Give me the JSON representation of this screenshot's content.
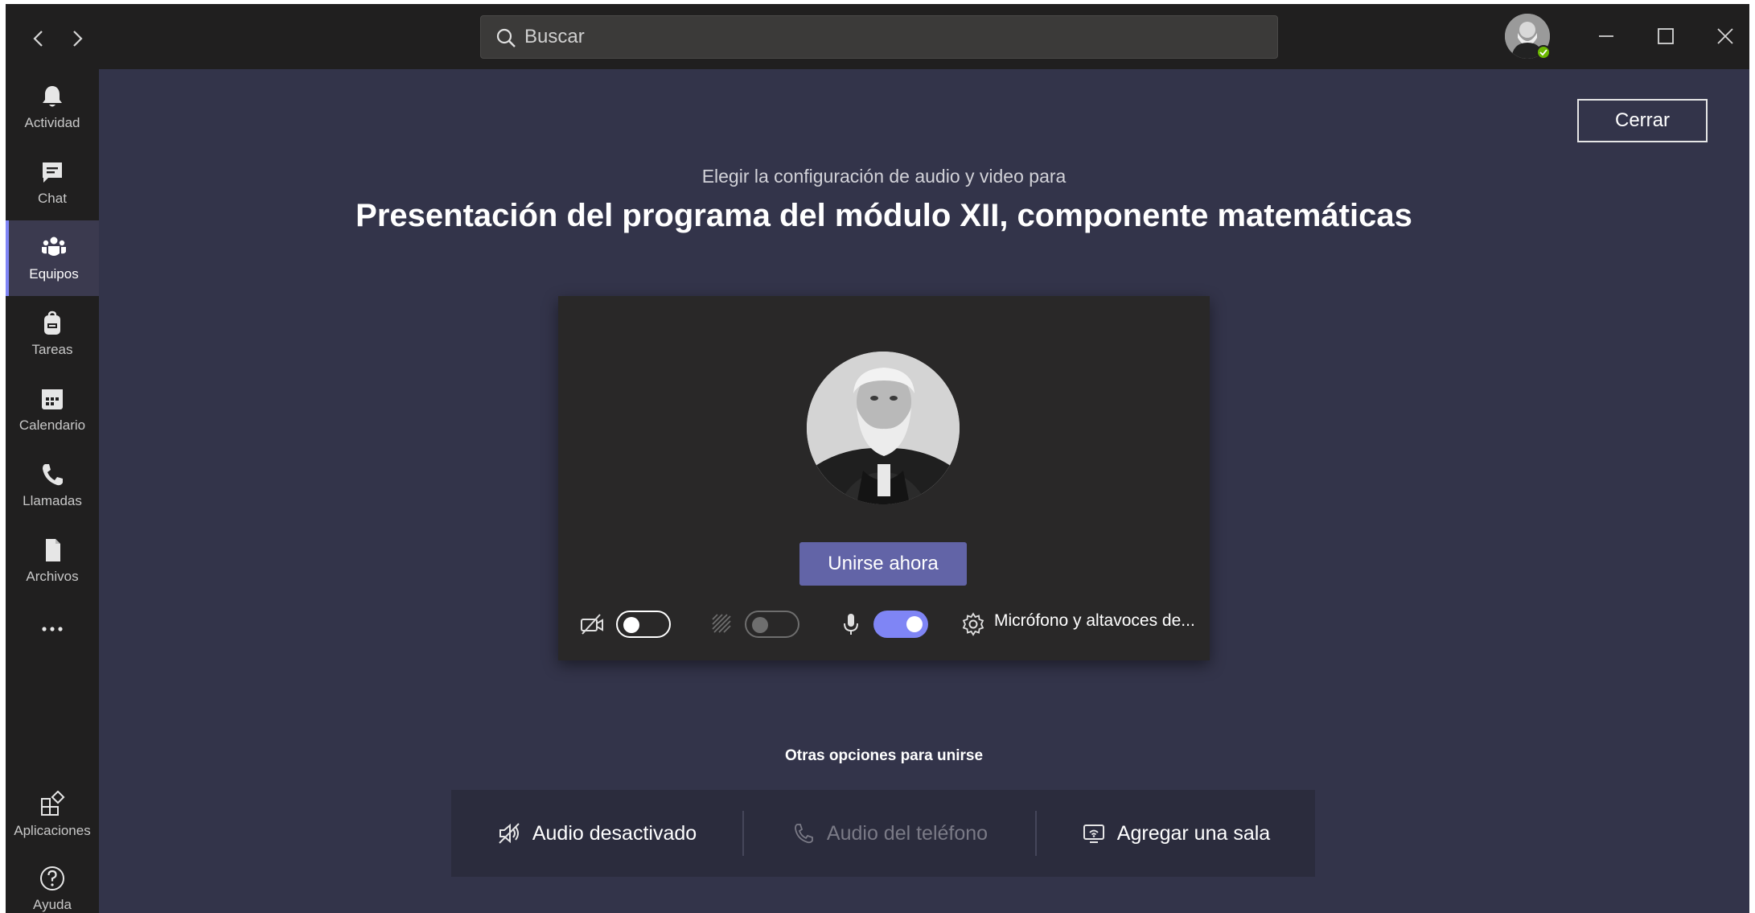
{
  "colors": {
    "titlebar": "#201f1f",
    "main_background": "#33344a",
    "accent": "#6264a7",
    "toggle_on": "#7f85f5",
    "presence_available": "#6bb700"
  },
  "titlebar": {
    "back_icon": "chevron-left-icon",
    "forward_icon": "chevron-right-icon",
    "search": {
      "placeholder": "Buscar",
      "value": ""
    },
    "presence": "available",
    "window_controls": [
      "minimize-icon",
      "maximize-icon",
      "close-icon"
    ]
  },
  "rail": {
    "items": [
      {
        "label": "Actividad",
        "icon": "bell-icon",
        "active": false
      },
      {
        "label": "Chat",
        "icon": "chat-icon",
        "active": false
      },
      {
        "label": "Equipos",
        "icon": "teams-icon",
        "active": true
      },
      {
        "label": "Tareas",
        "icon": "backpack-icon",
        "active": false
      },
      {
        "label": "Calendario",
        "icon": "calendar-icon",
        "active": false
      },
      {
        "label": "Llamadas",
        "icon": "phone-icon",
        "active": false
      },
      {
        "label": "Archivos",
        "icon": "file-icon",
        "active": false
      }
    ],
    "more_icon": "more-icon",
    "bottom": [
      {
        "label": "Aplicaciones",
        "icon": "apps-icon"
      },
      {
        "label": "Ayuda",
        "icon": "help-icon"
      }
    ]
  },
  "main": {
    "close_label": "Cerrar",
    "subtitle": "Elegir la configuración de audio y video para",
    "title": "Presentación del programa del módulo XII, componente matemáticas",
    "join_label": "Unirse ahora",
    "controls": {
      "camera_on": false,
      "background_blur_on": false,
      "microphone_on": true,
      "device_label": "Micrófono y altavoces de..."
    },
    "other_options_title": "Otras opciones para unirse",
    "other_options": [
      {
        "label": "Audio desactivado",
        "icon": "speaker-off-icon",
        "enabled": true
      },
      {
        "label": "Audio del teléfono",
        "icon": "phone-icon",
        "enabled": false
      },
      {
        "label": "Agregar una sala",
        "icon": "room-cast-icon",
        "enabled": true
      }
    ]
  }
}
